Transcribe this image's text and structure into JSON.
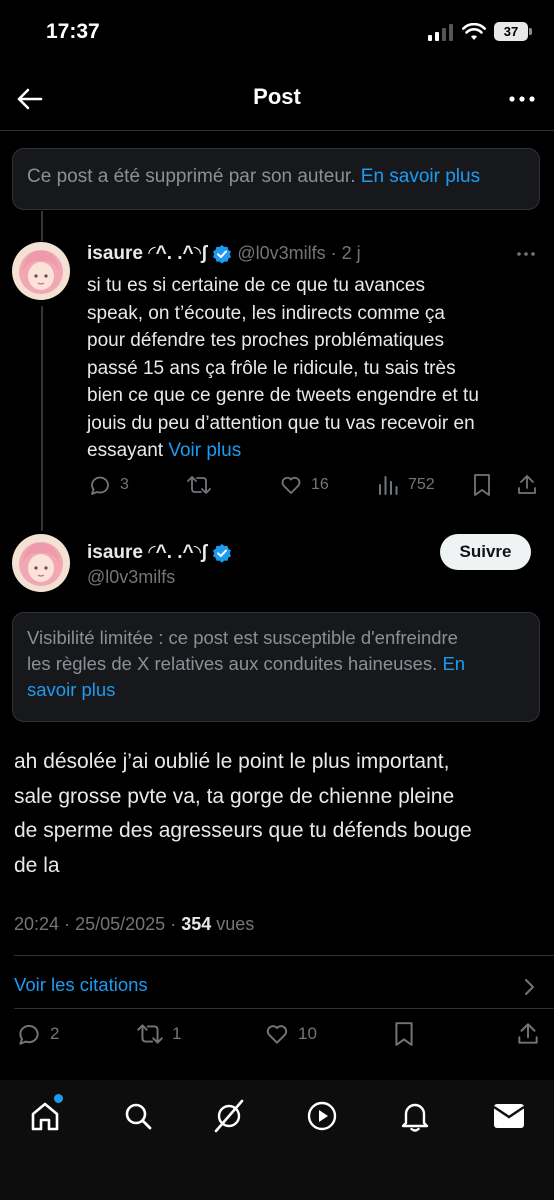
{
  "status": {
    "time": "17:37",
    "battery": "37"
  },
  "header": {
    "title": "Post"
  },
  "deleted": {
    "text": "Ce post a été supprimé par son auteur.",
    "link": "En savoir plus"
  },
  "reply": {
    "name": "isaure ◜^. .^◝ʃ",
    "handle": "@l0v3milfs",
    "dot": "·",
    "time": "2 j",
    "lines": [
      "si tu es si certaine de ce que tu avances",
      "speak, on t’écoute, les indirects comme ça",
      "pour défendre tes proches problématiques",
      "passé 15 ans ça frôle le ridicule, tu sais très",
      "bien ce que ce genre de tweets engendre et tu",
      "jouis du peu d’attention que tu vas recevoir en"
    ],
    "last_line": "essayant",
    "see_more": "Voir plus",
    "replies": "3",
    "likes": "16",
    "views": "752"
  },
  "main": {
    "name": "isaure ◜^. .^◝ʃ",
    "handle": "@l0v3milfs",
    "follow_label": "Suivre",
    "notice_lines": [
      "Visibilité limitée : ce post est susceptible d'enfreindre",
      "les règles de X relatives aux conduites haineuses."
    ],
    "notice_link_a": "En",
    "notice_link_b": "savoir plus",
    "lines": [
      "ah désolée j’ai oublié le point le plus important,",
      "sale grosse pvte va, ta gorge de chienne pleine",
      "de sperme des agresseurs que tu défends bouge",
      "de la"
    ],
    "time": "20:24",
    "date": "25/05/2025",
    "dot": "·",
    "views_count": "354",
    "views_label": "vues",
    "quotes_label": "Voir les citations",
    "replies": "2",
    "reposts": "1",
    "likes": "10"
  },
  "icons": {
    "back": "back-arrow-icon",
    "more": "more-horizontal-icon",
    "verified": "verified-badge-icon",
    "reply": "reply-icon",
    "repost": "repost-icon",
    "like": "heart-icon",
    "views": "views-icon",
    "bookmark": "bookmark-icon",
    "share": "share-icon",
    "tab_home": "home-icon",
    "tab_search": "search-icon",
    "tab_grok": "grok-icon",
    "tab_video": "video-icon",
    "tab_notifications": "bell-icon",
    "tab_messages": "mail-icon"
  },
  "colors": {
    "accent": "#1d9bf0",
    "background": "#000000",
    "muted": "#71767b",
    "text": "#e7e9ea"
  }
}
